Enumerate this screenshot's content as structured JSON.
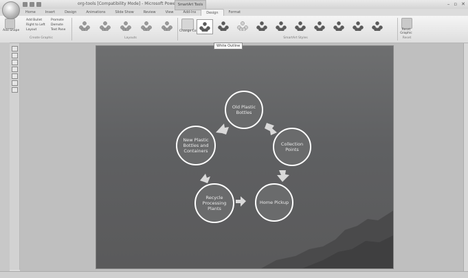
{
  "window": {
    "title": "org-tools [Compatibility Mode] - Microsoft PowerPoint",
    "context_tab": "SmartArt Tools",
    "controls": [
      "–",
      "▫",
      "✕"
    ]
  },
  "tabs": [
    {
      "label": "Home"
    },
    {
      "label": "Insert"
    },
    {
      "label": "Design"
    },
    {
      "label": "Animations"
    },
    {
      "label": "Slide Show"
    },
    {
      "label": "Review"
    },
    {
      "label": "View"
    },
    {
      "label": "Add-Ins"
    },
    {
      "label": "Design",
      "active": true
    },
    {
      "label": "Format"
    }
  ],
  "ribbon": {
    "create_graphic": {
      "add_shape": "Add Shape",
      "add_bullet": "Add Bullet",
      "right_to_left": "Right to Left",
      "layout": "Layout",
      "promote": "Promote",
      "demote": "Demote",
      "text_pane": "Text Pane",
      "group_label": "Create Graphic"
    },
    "layouts": {
      "group_label": "Layouts"
    },
    "change_colors": "Change Colors",
    "smartart_styles": {
      "group_label": "SmartArt Styles"
    },
    "reset": {
      "label": "Reset Graphic",
      "group_label": "Reset"
    }
  },
  "tooltip": "White Outline",
  "slide": {
    "nodes": [
      {
        "label": "Old Plastic Bottles"
      },
      {
        "label": "Collection Points"
      },
      {
        "label": "Home Pickup"
      },
      {
        "label": "Recycle Processing Plants"
      },
      {
        "label": "New Plastic Bottles and Containers"
      }
    ],
    "colors": {
      "background": "#646566",
      "circle_border": "#ffffff",
      "arrow": "#d9d9d9"
    }
  }
}
